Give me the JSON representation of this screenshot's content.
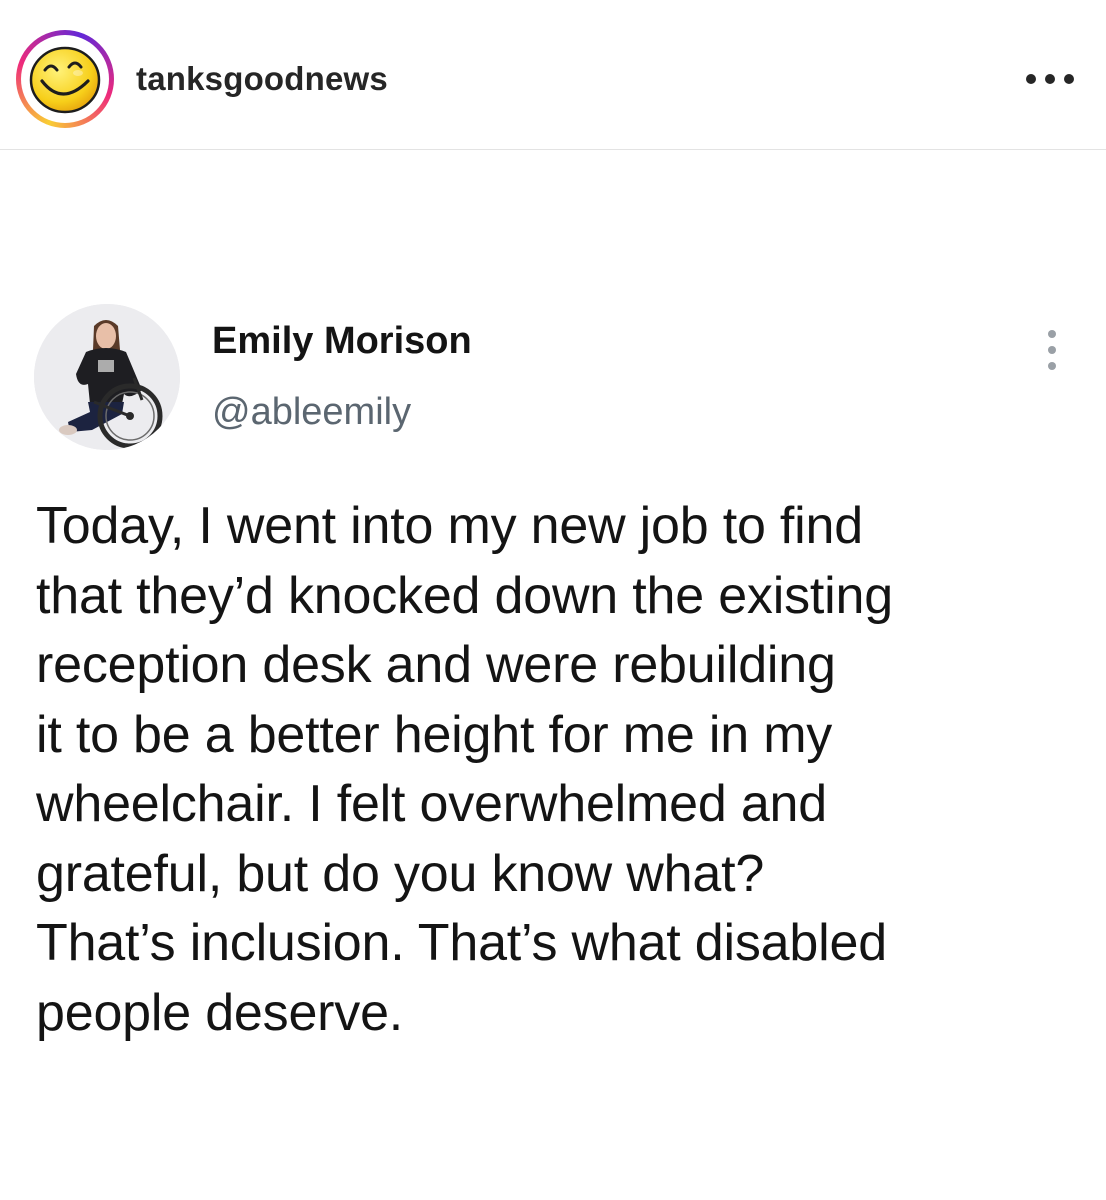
{
  "instagram_header": {
    "username": "tanksgoodnews",
    "avatar_icon": "smiley-face-icon",
    "more_icon": "more-horizontal-icon",
    "ring_colors": [
      "#f9ce34",
      "#ee2a7b",
      "#6228d7"
    ]
  },
  "tweet": {
    "author_name": "Emily Morison",
    "author_handle": "@ableemily",
    "avatar": "profile-photo-woman-in-wheelchair",
    "more_icon": "more-vertical-icon",
    "text_lines": [
      "Today, I went into my new job to find",
      "that they’d knocked down the existing",
      "reception desk and were rebuilding",
      "it to be a better height for me in my",
      "wheelchair. I felt overwhelmed and",
      "grateful, but do you know what?",
      "That’s inclusion. That’s what disabled",
      "people deserve."
    ],
    "handle_color": "#5b6670",
    "text_color": "#141414"
  }
}
